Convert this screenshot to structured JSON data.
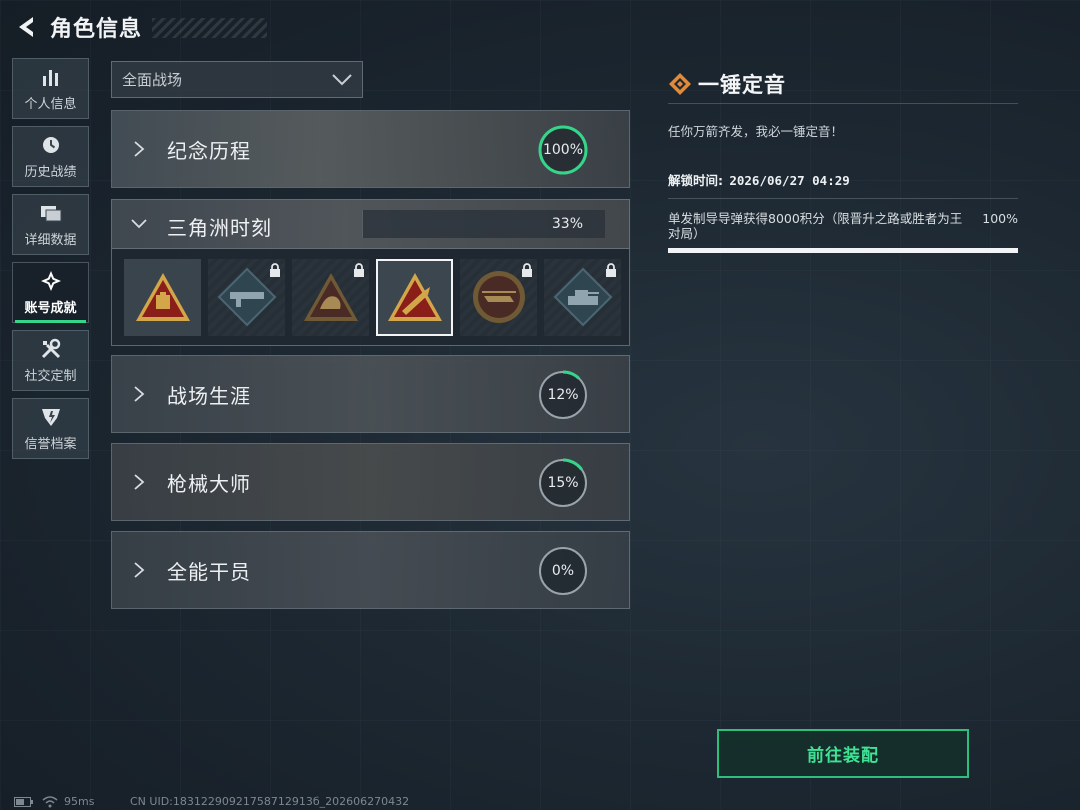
{
  "header": {
    "title": "角色信息"
  },
  "nav": {
    "items": [
      {
        "label": "个人信息",
        "icon": "bar-chart-icon"
      },
      {
        "label": "历史战绩",
        "icon": "clock-icon"
      },
      {
        "label": "详细数据",
        "icon": "cards-icon"
      },
      {
        "label": "账号成就",
        "icon": "achievement-icon",
        "active": true
      },
      {
        "label": "社交定制",
        "icon": "tools-icon"
      },
      {
        "label": "信誉档案",
        "icon": "shield-icon"
      }
    ]
  },
  "filter": {
    "value": "全面战场"
  },
  "categories": [
    {
      "name": "纪念历程",
      "progress": "100%",
      "fraction": 1.0,
      "expanded": false
    },
    {
      "name": "三角洲时刻",
      "progress": "33%",
      "fraction": 0.33,
      "expanded": true
    },
    {
      "name": "战场生涯",
      "progress": "12%",
      "fraction": 0.12,
      "expanded": false
    },
    {
      "name": "枪械大师",
      "progress": "15%",
      "fraction": 0.15,
      "expanded": false
    },
    {
      "name": "全能干员",
      "progress": "0%",
      "fraction": 0.0,
      "expanded": false
    }
  ],
  "badges": [
    {
      "icon": "crate-emblem-icon",
      "locked": false,
      "selected": false
    },
    {
      "icon": "rocket-launcher-emblem-icon",
      "locked": true,
      "selected": false
    },
    {
      "icon": "hand-grip-emblem-icon",
      "locked": true,
      "selected": false
    },
    {
      "icon": "missile-emblem-icon",
      "locked": false,
      "selected": true
    },
    {
      "icon": "helicopter-emblem-icon",
      "locked": true,
      "selected": false
    },
    {
      "icon": "tank-emblem-icon",
      "locked": true,
      "selected": false
    }
  ],
  "detail": {
    "title": "一锤定音",
    "description": "任你万箭齐发，我必一锤定音！",
    "unlock_label": "解锁时间:",
    "unlock_time": "2026/06/27 04:29",
    "condition": "单发制导导弹获得8000积分（限晋升之路或胜者为王对局）",
    "condition_progress": "100%",
    "condition_fraction": 1.0
  },
  "equip_button": {
    "label": "前往装配"
  },
  "footer": {
    "ping": "95ms",
    "uid": "CN UID:18312290921758712913б_202606270432"
  },
  "colors": {
    "accent": "#35d58a",
    "ring_track": "#9aa3aa",
    "badge_gold": "#d4a64a",
    "badge_red": "#8a1f1a"
  }
}
